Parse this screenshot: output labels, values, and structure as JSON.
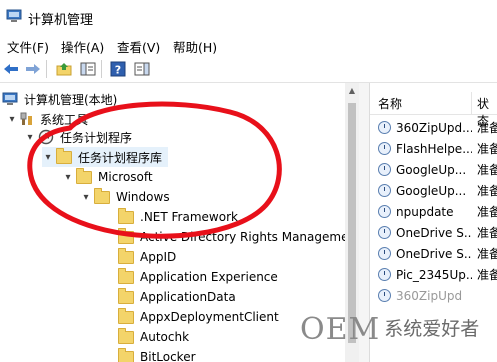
{
  "window": {
    "title": "计算机管理"
  },
  "menu": [
    "文件(F)",
    "操作(A)",
    "查看(V)",
    "帮助(H)"
  ],
  "toolbar": [
    "back-arrow-icon",
    "forward-arrow-icon",
    "up-folder-icon",
    "show-hide-tree-icon",
    "help-icon",
    "action-pane-icon"
  ],
  "tree": {
    "root": "计算机管理(本地)",
    "system_tools": "系统工具",
    "task_scheduler": "任务计划程序",
    "library": "任务计划程序库",
    "microsoft": "Microsoft",
    "windows": "Windows",
    "children": [
      ".NET Framework",
      "Active Directory Rights Management",
      "AppID",
      "Application Experience",
      "ApplicationData",
      "AppxDeploymentClient",
      "Autochk",
      "BitLocker"
    ]
  },
  "tasks": {
    "col_name": "名称",
    "col_status": "状态",
    "rows": [
      {
        "name": "360ZipUpd...",
        "status": "准备"
      },
      {
        "name": "FlashHelpe...",
        "status": "准备"
      },
      {
        "name": "GoogleUp...",
        "status": "准备"
      },
      {
        "name": "GoogleUp...",
        "status": "准备"
      },
      {
        "name": "npupdate",
        "status": "准备"
      },
      {
        "name": "OneDrive S...",
        "status": "准备"
      },
      {
        "name": "OneDrive S...",
        "status": "准备"
      },
      {
        "name": "Pic_2345Up...",
        "status": "准备"
      }
    ],
    "partial_bottom": "360ZipUpd"
  },
  "watermark": {
    "brand": "OEM",
    "text": "系统爱好者"
  },
  "colors": {
    "annotation_red": "#e8101a",
    "folder": "#f3d46a"
  }
}
